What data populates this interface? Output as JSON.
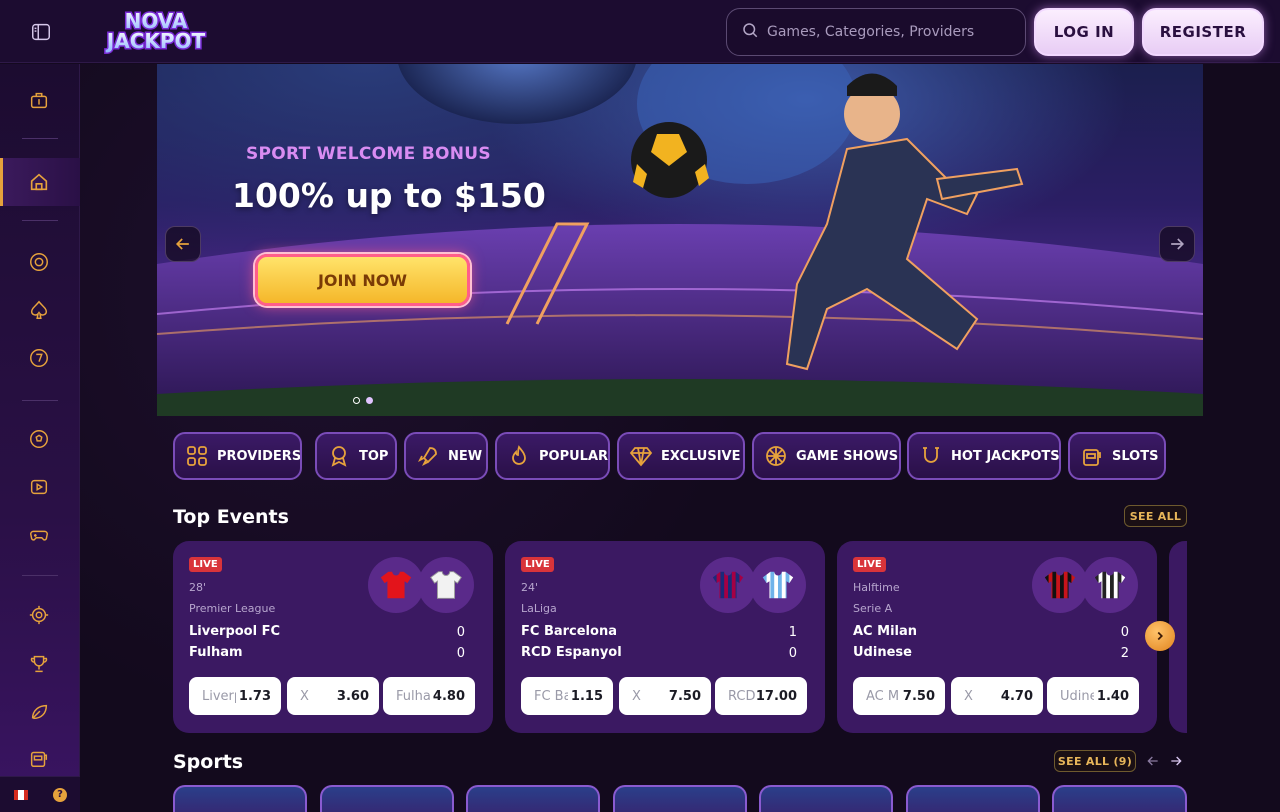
{
  "header": {
    "logo_alt": "NOVA JACKPOT",
    "search_placeholder": "Games, Categories, Providers",
    "login_label": "LOG IN",
    "register_label": "REGISTER"
  },
  "banner": {
    "subtitle": "SPORT WELCOME BONUS",
    "title": "100% up to $150",
    "cta_label": "JOIN NOW",
    "slide_count": 2,
    "active_slide": 2
  },
  "categories": [
    {
      "label": "PROVIDERS",
      "icon": "grid-icon"
    },
    {
      "label": "TOP",
      "icon": "award-icon"
    },
    {
      "label": "NEW",
      "icon": "rocket-icon"
    },
    {
      "label": "POPULAR",
      "icon": "flame-icon"
    },
    {
      "label": "EXCLUSIVE",
      "icon": "diamond-icon"
    },
    {
      "label": "GAME SHOWS",
      "icon": "ball-icon"
    },
    {
      "label": "HOT JACKPOTS",
      "icon": "horseshoe-icon"
    },
    {
      "label": "SLOTS",
      "icon": "slot-machine-icon"
    }
  ],
  "top_events": {
    "title": "Top Events",
    "see_all_label": "SEE ALL",
    "events": [
      {
        "status": "LIVE",
        "time": "28'",
        "league": "Premier League",
        "home": "Liverpool FC",
        "away": "Fulham",
        "home_score": "0",
        "away_score": "0",
        "odds": [
          {
            "label": "Liverpool FC",
            "value": "1.73"
          },
          {
            "label": "X",
            "value": "3.60"
          },
          {
            "label": "Fulham",
            "value": "4.80"
          }
        ],
        "home_color": "#e3141b",
        "away_color": "#ffffff"
      },
      {
        "status": "LIVE",
        "time": "24'",
        "league": "LaLiga",
        "home": "FC Barcelona",
        "away": "RCD Espanyol",
        "home_score": "1",
        "away_score": "0",
        "odds": [
          {
            "label": "FC Barcelona",
            "value": "1.15"
          },
          {
            "label": "X",
            "value": "7.50"
          },
          {
            "label": "RCD Espanyol",
            "value": "17.00"
          }
        ],
        "home_color": "#1a2a7a",
        "away_color": "#7ab8e8"
      },
      {
        "status": "LIVE",
        "time": "Halftime",
        "league": "Serie A",
        "home": "AC Milan",
        "away": "Udinese",
        "home_score": "0",
        "away_score": "2",
        "odds": [
          {
            "label": "AC Milan",
            "value": "7.50"
          },
          {
            "label": "X",
            "value": "4.70"
          },
          {
            "label": "Udinese",
            "value": "1.40"
          }
        ],
        "home_color": "#c8141b",
        "away_color": "#222222"
      }
    ]
  },
  "sports": {
    "title": "Sports",
    "see_all_label": "SEE ALL (9)"
  },
  "colors": {
    "accent": "#e6a23c",
    "background": "#130a1d",
    "card": "#3b1962",
    "live": "#d9343a"
  }
}
